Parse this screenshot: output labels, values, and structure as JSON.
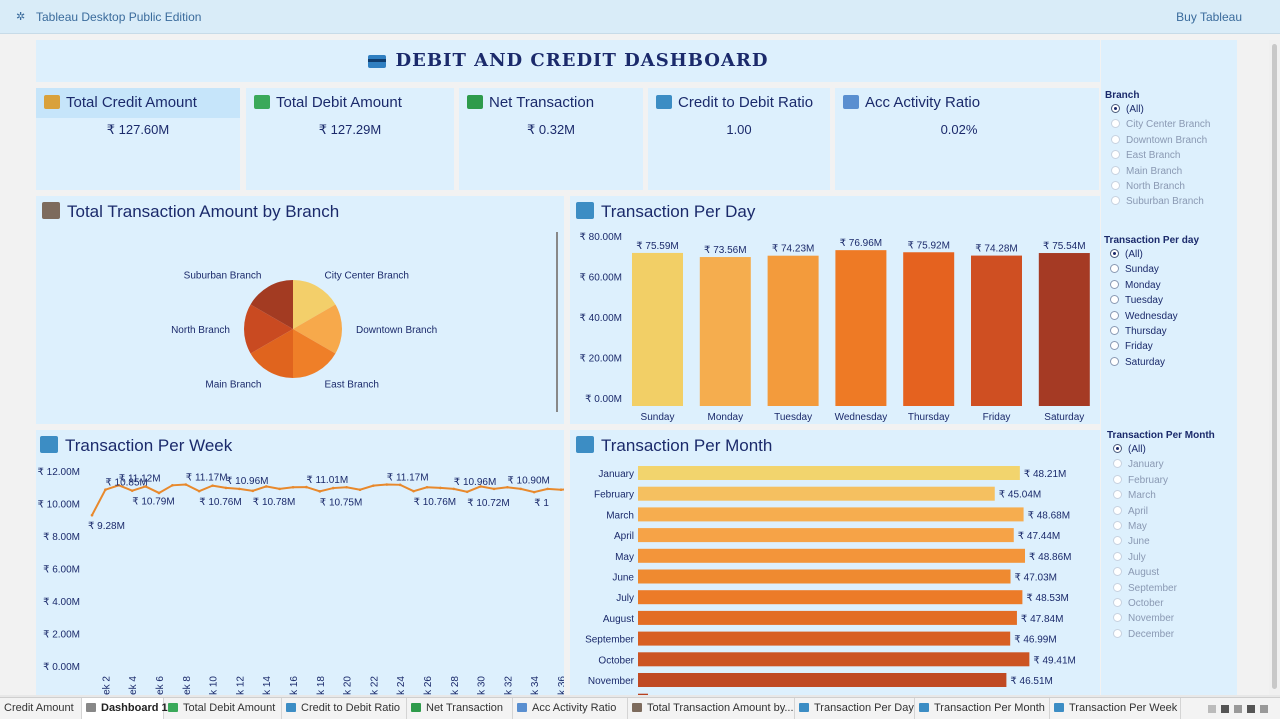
{
  "app": {
    "title": "Tableau Desktop Public Edition",
    "buy": "Buy Tableau"
  },
  "dashboard": {
    "title": "DEBIT AND CREDIT DASHBOARD"
  },
  "kpis": [
    {
      "label": "Total Credit Amount",
      "value": "₹ 127.60M",
      "icon": "money-bag-icon",
      "color": "#d9a13b"
    },
    {
      "label": "Total Debit Amount",
      "value": "₹ 127.29M",
      "icon": "flying-money-icon",
      "color": "#3aa95a"
    },
    {
      "label": "Net Transaction",
      "value": "₹ 0.32M",
      "icon": "banknote-icon",
      "color": "#2e9b4b"
    },
    {
      "label": "Credit to Debit Ratio",
      "value": "1.00",
      "icon": "bar-chart-icon",
      "color": "#3c8dc4"
    },
    {
      "label": "Acc Activity Ratio",
      "value": "0.02%",
      "icon": "trend-chart-icon",
      "color": "#5a8fd0"
    }
  ],
  "sections": {
    "branch": "Total Transaction Amount by Branch",
    "day": "Transaction Per Day",
    "week": "Transaction Per Week",
    "month": "Transaction Per Month"
  },
  "chart_data": [
    {
      "type": "pie",
      "title": "Total Transaction Amount by Branch",
      "categories": [
        "City Center Branch",
        "Downtown Branch",
        "East Branch",
        "Main Branch",
        "North Branch",
        "Suburban Branch"
      ],
      "values": [
        1,
        1,
        1,
        1,
        1,
        1
      ],
      "colors": [
        "#f3cf6a",
        "#f7a94b",
        "#ef7f28",
        "#e0641e",
        "#c94a21",
        "#a33b22"
      ]
    },
    {
      "type": "bar",
      "title": "Transaction Per Day",
      "categories": [
        "Sunday",
        "Monday",
        "Tuesday",
        "Wednesday",
        "Thursday",
        "Friday",
        "Saturday"
      ],
      "values": [
        75.59,
        73.56,
        74.23,
        76.96,
        75.92,
        74.28,
        75.54
      ],
      "labels": [
        "₹ 75.59M",
        "₹ 73.56M",
        "₹ 74.23M",
        "₹ 76.96M",
        "₹ 75.92M",
        "₹ 74.28M",
        "₹ 75.54M"
      ],
      "yticks": [
        "₹ 80.00M",
        "₹ 60.00M",
        "₹ 40.00M",
        "₹ 20.00M",
        "₹ 0.00M"
      ],
      "ylim": [
        0,
        80
      ],
      "colors": [
        "#f2cf66",
        "#f5ad4e",
        "#f39b3c",
        "#ee7a25",
        "#e5621f",
        "#cf4f22",
        "#a53a24"
      ]
    },
    {
      "type": "line",
      "title": "Transaction Per Week",
      "x": [
        1,
        2,
        3,
        4,
        5,
        6,
        7,
        8,
        9,
        10,
        11,
        12,
        13,
        14,
        15,
        16,
        17,
        18,
        19,
        20,
        21,
        22,
        23,
        24,
        25,
        26,
        27,
        28,
        29,
        30,
        31,
        32,
        33,
        34,
        35,
        36,
        37
      ],
      "values": [
        9.28,
        10.85,
        11.12,
        10.79,
        11.05,
        10.65,
        11.12,
        11.17,
        10.76,
        11.1,
        10.96,
        10.9,
        10.78,
        11.05,
        10.9,
        11.0,
        11.01,
        10.75,
        10.95,
        11.0,
        10.85,
        11.1,
        11.17,
        11.15,
        10.76,
        11.0,
        10.96,
        10.9,
        10.72,
        11.05,
        10.9,
        11.0,
        10.9,
        10.7,
        10.9,
        10.85,
        10.9
      ],
      "point_labels": [
        {
          "i": 0,
          "text": "₹ 9.28M",
          "pos": "below"
        },
        {
          "i": 1,
          "text": "₹ 10.85M",
          "pos": "above"
        },
        {
          "i": 2,
          "text": "₹ 11.12M",
          "pos": "above"
        },
        {
          "i": 3,
          "text": "₹ 10.79M",
          "pos": "below"
        },
        {
          "i": 7,
          "text": "₹ 11.17M",
          "pos": "above"
        },
        {
          "i": 8,
          "text": "₹ 10.76M",
          "pos": "below"
        },
        {
          "i": 10,
          "text": "₹ 10.96M",
          "pos": "above"
        },
        {
          "i": 12,
          "text": "₹ 10.78M",
          "pos": "below"
        },
        {
          "i": 16,
          "text": "₹ 11.01M",
          "pos": "above"
        },
        {
          "i": 17,
          "text": "₹ 10.75M",
          "pos": "below"
        },
        {
          "i": 22,
          "text": "₹ 11.17M",
          "pos": "above"
        },
        {
          "i": 24,
          "text": "₹ 10.76M",
          "pos": "below"
        },
        {
          "i": 27,
          "text": "₹ 10.96M",
          "pos": "above"
        },
        {
          "i": 28,
          "text": "₹ 10.72M",
          "pos": "below"
        },
        {
          "i": 31,
          "text": "₹ 10.90M",
          "pos": "above"
        },
        {
          "i": 33,
          "text": "₹ 1",
          "pos": "below"
        }
      ],
      "yticks": [
        "₹ 12.00M",
        "₹ 10.00M",
        "₹ 8.00M",
        "₹ 6.00M",
        "₹ 4.00M",
        "₹ 2.00M",
        "₹ 0.00M"
      ],
      "ylim": [
        0,
        12
      ],
      "xtick_labels": [
        "ek 2",
        "ek 4",
        "ek 6",
        "ek 8",
        "k 10",
        "k 12",
        "k 14",
        "k 16",
        "k 18",
        "k 20",
        "k 22",
        "k 24",
        "k 26",
        "k 28",
        "k 30",
        "k 32",
        "k 34",
        "k 36"
      ],
      "color": "#e8892c"
    },
    {
      "type": "bar",
      "orientation": "horizontal",
      "title": "Transaction Per Month",
      "categories": [
        "January",
        "February",
        "March",
        "April",
        "May",
        "June",
        "July",
        "August",
        "September",
        "October",
        "November"
      ],
      "values": [
        48.21,
        45.04,
        48.68,
        47.44,
        48.86,
        47.03,
        48.53,
        47.84,
        46.99,
        49.41,
        46.51
      ],
      "labels": [
        "₹ 48.21M",
        "₹ 45.04M",
        "₹ 48.68M",
        "₹ 47.44M",
        "₹ 48.86M",
        "₹ 47.03M",
        "₹ 48.53M",
        "₹ 47.84M",
        "₹ 46.99M",
        "₹ 49.41M",
        "₹ 46.51M"
      ],
      "colors": [
        "#f2d46d",
        "#f5c060",
        "#f6ad4f",
        "#f6a347",
        "#f3953a",
        "#ef8a30",
        "#ec7b28",
        "#e36d24",
        "#d85f22",
        "#cc5423",
        "#c04a23"
      ]
    }
  ],
  "filters": {
    "branch": {
      "title": "Branch",
      "options": [
        "(All)",
        "City Center Branch",
        "Downtown Branch",
        "East Branch",
        "Main Branch",
        "North Branch",
        "Suburban Branch"
      ]
    },
    "day": {
      "title": "Transaction Per day",
      "options": [
        "(All)",
        "Sunday",
        "Monday",
        "Tuesday",
        "Wednesday",
        "Thursday",
        "Friday",
        "Saturday"
      ]
    },
    "month": {
      "title": "Transaction Per Month",
      "options": [
        "(All)",
        "January",
        "February",
        "March",
        "April",
        "May",
        "June",
        "July",
        "August",
        "September",
        "October",
        "November",
        "December"
      ]
    }
  },
  "tabs": [
    {
      "label": "Credit Amount",
      "icon": "",
      "active": false
    },
    {
      "label": "Dashboard 1",
      "icon": "dashboard-icon",
      "active": true
    },
    {
      "label": "Total Debit Amount",
      "icon": "flying-money-icon",
      "active": false
    },
    {
      "label": "Credit to Debit Ratio",
      "icon": "bar-chart-icon",
      "active": false
    },
    {
      "label": "Net Transaction",
      "icon": "banknote-icon",
      "active": false
    },
    {
      "label": "Acc Activity Ratio",
      "icon": "trend-chart-icon",
      "active": false
    },
    {
      "label": "Total Transaction Amount by...",
      "icon": "bank-icon",
      "active": false
    },
    {
      "label": "Transaction Per Day",
      "icon": "bar-chart-icon",
      "active": false
    },
    {
      "label": "Transaction Per Month",
      "icon": "bar-chart-icon",
      "active": false
    },
    {
      "label": "Transaction Per Week",
      "icon": "bar-chart-icon",
      "active": false
    }
  ]
}
